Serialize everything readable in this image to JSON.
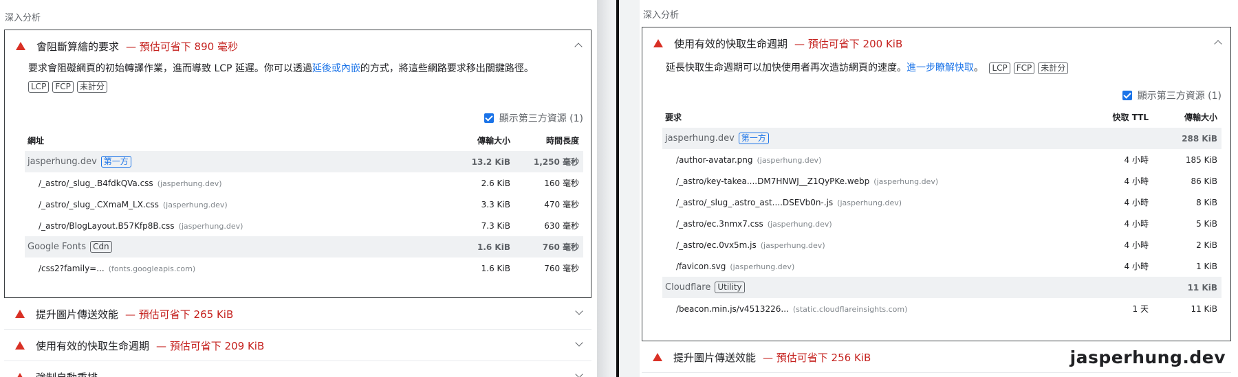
{
  "left": {
    "section_heading": "深入分析",
    "expanded_audit": {
      "title": "會阻斷算繪的要求",
      "savings": "— 預估可省下 890 毫秒",
      "description_before": "要求會阻礙網頁的初始轉譯作業，進而導致 LCP 延遲。你可以透過",
      "description_link": "延後或內嵌",
      "description_after": "的方式，將這些網路要求移出關鍵路徑。",
      "chips": [
        "LCP",
        "FCP",
        "未計分"
      ],
      "third_party_label": "顯示第三方資源 (1)",
      "columns": [
        "網址",
        "傳輸大小",
        "時間長度"
      ],
      "groups": [
        {
          "entity": "jasperhung.dev",
          "tag": "第一方",
          "size": "13.2 KiB",
          "duration": "1,250 毫秒",
          "rows": [
            {
              "url": "/_astro/_slug_.B4fdkQVa.css",
              "host": "(jasperhung.dev)",
              "size": "2.6 KiB",
              "duration": "160 毫秒"
            },
            {
              "url": "/_astro/_slug_.CXmaM_LX.css",
              "host": "(jasperhung.dev)",
              "size": "3.3 KiB",
              "duration": "470 毫秒"
            },
            {
              "url": "/_astro/BlogLayout.B57Kfp8B.css",
              "host": "(jasperhung.dev)",
              "size": "7.3 KiB",
              "duration": "630 毫秒"
            }
          ]
        },
        {
          "entity": "Google Fonts",
          "tag": "Cdn",
          "size": "1.6 KiB",
          "duration": "760 毫秒",
          "rows": [
            {
              "url": "/css2?family=...",
              "host": "(fonts.googleapis.com)",
              "size": "1.6 KiB",
              "duration": "760 毫秒"
            }
          ]
        }
      ]
    },
    "collapsed_audits": [
      {
        "title": "提升圖片傳送效能",
        "savings": "— 預估可省下 265 KiB"
      },
      {
        "title": "使用有效的快取生命週期",
        "savings": "— 預估可省下 209 KiB"
      },
      {
        "title": "強制自動重排",
        "savings": ""
      }
    ]
  },
  "right": {
    "section_heading": "深入分析",
    "expanded_audit": {
      "title": "使用有效的快取生命週期",
      "savings": "— 預估可省下 200 KiB",
      "description_before": "延長快取生命週期可以加快使用者再次造訪網頁的速度。",
      "description_link": "進一步瞭解快取",
      "description_after": "。",
      "chips": [
        "LCP",
        "FCP",
        "未計分"
      ],
      "third_party_label": "顯示第三方資源 (1)",
      "columns": [
        "要求",
        "快取 TTL",
        "傳輸大小"
      ],
      "groups": [
        {
          "entity": "jasperhung.dev",
          "tag": "第一方",
          "ttl": "",
          "size": "288 KiB",
          "rows": [
            {
              "url": "/author-avatar.png",
              "host": "(jasperhung.dev)",
              "ttl": "4 小時",
              "size": "185 KiB"
            },
            {
              "url": "/_astro/key-takea....DM7HNWJ__Z1QyPKe.webp",
              "host": "(jasperhung.dev)",
              "ttl": "4 小時",
              "size": "86 KiB"
            },
            {
              "url": "/_astro/_slug_.astro_ast....DSEVb0n-.js",
              "host": "(jasperhung.dev)",
              "ttl": "4 小時",
              "size": "8 KiB"
            },
            {
              "url": "/_astro/ec.3nmx7.css",
              "host": "(jasperhung.dev)",
              "ttl": "4 小時",
              "size": "5 KiB"
            },
            {
              "url": "/_astro/ec.0vx5m.js",
              "host": "(jasperhung.dev)",
              "ttl": "4 小時",
              "size": "2 KiB"
            },
            {
              "url": "/favicon.svg",
              "host": "(jasperhung.dev)",
              "ttl": "4 小時",
              "size": "1 KiB"
            }
          ]
        },
        {
          "entity": "Cloudflare",
          "tag": "Utility",
          "ttl": "",
          "size": "11 KiB",
          "rows": [
            {
              "url": "/beacon.min.js/v4513226...",
              "host": "(static.cloudflareinsights.com)",
              "ttl": "1 天",
              "size": "11 KiB"
            }
          ]
        }
      ]
    },
    "collapsed_audits": [
      {
        "title": "提升圖片傳送效能",
        "savings": "— 預估可省下 256 KiB"
      }
    ]
  },
  "watermark": "jasperhung.dev",
  "colors": {
    "fail": "#d93025",
    "savings": "#c5221f",
    "link": "#1a73e8",
    "group_bg": "#eff1f3"
  },
  "icons": [
    "fail-triangle-icon",
    "chevron-up-icon",
    "chevron-down-icon",
    "checkbox-checked-icon"
  ]
}
